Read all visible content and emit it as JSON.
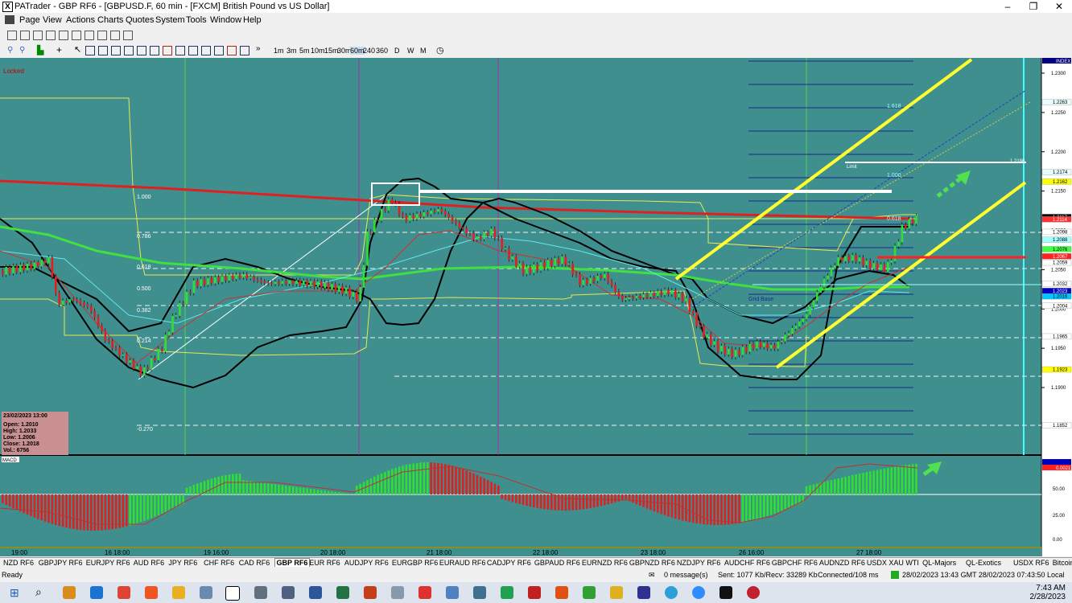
{
  "window": {
    "title": "PATrader - GBP RF6 - [GBPUSD.F, 60 min - [FXCM] British Pound vs US Dollar]"
  },
  "menu": [
    "Page",
    "View",
    "Actions",
    "Charts",
    "Quotes",
    "System",
    "Tools",
    "Window",
    "Help"
  ],
  "timeframes": [
    "1m",
    "3m",
    "5m",
    "10m",
    "15m",
    "30m",
    "60m",
    "240",
    "360",
    "D",
    "W",
    "M"
  ],
  "chart": {
    "locked": "Locked",
    "index": "INDEX",
    "price_axis": [
      "1.2300",
      "1.2250",
      "1.2200",
      "1.2150",
      "1.2100",
      "1.2050",
      "1.2000",
      "1.1950",
      "1.1900"
    ],
    "price_tags": [
      {
        "v": "1.2263",
        "c": "#e8fdfd",
        "t": "#000"
      },
      {
        "v": "1.2174",
        "c": "#e8fdfd",
        "t": "#000"
      },
      {
        "v": "1.2162",
        "c": "#ffff00",
        "t": "#000"
      },
      {
        "v": "1.2117",
        "c": "#000000",
        "t": "#fff"
      },
      {
        "v": "1.2114",
        "c": "#ff3030",
        "t": "#fff"
      },
      {
        "v": "1.2098",
        "c": "#ffffff",
        "t": "#000"
      },
      {
        "v": "1.2088",
        "c": "#a0ffff",
        "t": "#000"
      },
      {
        "v": "1.2076",
        "c": "#40ff40",
        "t": "#000"
      },
      {
        "v": "1.2067",
        "c": "#ff2020",
        "t": "#fff"
      },
      {
        "v": "1.2059",
        "c": "#ffffff",
        "t": "#000"
      },
      {
        "v": "1.2032",
        "c": "#ffffff",
        "t": "#000"
      },
      {
        "v": "1.2023",
        "c": "#0000c0",
        "t": "#fff"
      },
      {
        "v": "1.2016",
        "c": "#00c8ff",
        "t": "#000"
      },
      {
        "v": "1.2004",
        "c": "#ffffff",
        "t": "#000"
      },
      {
        "v": "1.1965",
        "c": "#ffffff",
        "t": "#000"
      },
      {
        "v": "1.1923",
        "c": "#ffff00",
        "t": "#000"
      },
      {
        "v": "1.1852",
        "c": "#ffffff",
        "t": "#000"
      }
    ],
    "fib_left": [
      "1.000",
      "0.786",
      "0.618",
      "0.500",
      "0.382",
      "0.214",
      "-0.270"
    ],
    "fib_right": [
      "1.618",
      "1.000",
      "0.618"
    ],
    "labels": {
      "limit": "Limit",
      "limit_value": "1.2186",
      "grid_base": "Grid Base"
    },
    "ohlc": {
      "date": "23/02/2023 13:00",
      "open": "Open: 1.2010",
      "high": "High: 1.2033",
      "low": "Low: 1.2006",
      "close": "Close: 1.2018",
      "vol": "Vol.: 6756"
    },
    "macd": {
      "label": "MACD",
      "axis": [
        "50.00",
        "25.00",
        "0.00"
      ],
      "tag": "0.0021"
    },
    "time_axis": [
      "19:00",
      "16 18:00",
      "19 16:00",
      "20 18:00",
      "21 18:00",
      "22 18:00",
      "23 18:00",
      "26 16:00",
      "27 18:00"
    ]
  },
  "tabs": [
    "NZD RF6",
    "GBPJPY RF6",
    "EURJPY RF6",
    "AUD RF6",
    "JPY RF6",
    "CHF RF6",
    "CAD RF6",
    "GBP RF6",
    "EUR RF6",
    "AUDJPY RF6",
    "EURGBP RF6",
    "EURAUD RF6",
    "CADJPY RF6",
    "GBPAUD RF6",
    "EURNZD RF6",
    "GBPNZD RF6",
    "NZDJPY RF6",
    "AUDCHF RF6",
    "GBPCHF RF6",
    "AUDNZD RF6",
    "USDX XAU WTI",
    "QL-Majors",
    "QL-Exotics",
    "USDX RF6",
    "Bitcoin",
    "SP500"
  ],
  "status": {
    "ready": "Ready",
    "messages": "0 message(s)",
    "traffic": "Sent: 1077 Kb/Recv: 33289 Kb",
    "conn": "Connected/108 ms",
    "times": "28/02/2023 13:43 GMT  28/02/2023 07:43:50 Local"
  },
  "clock": {
    "time": "7:43 AM",
    "date": "2/28/2023"
  }
}
